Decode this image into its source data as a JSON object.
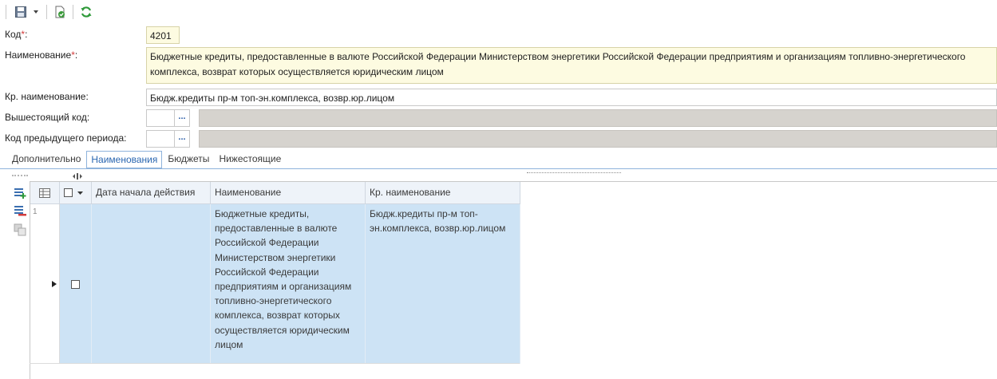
{
  "toolbar": {
    "save_icon": "save-icon",
    "dropdown_icon": "chevron-down-icon",
    "check_icon": "check-document-icon",
    "refresh_icon": "refresh-icon"
  },
  "form": {
    "code_label": "Код",
    "code_value": "4201",
    "name_label": "Наименование",
    "name_value": "Бюджетные кредиты, предоставленные в валюте Российской Федерации Министерством энергетики Российской Федерации предприятиям и организациям топливно-энергетического комплекса, возврат которых осуществляется юридическим лицом",
    "required_mark": "*",
    "label_colon": ":",
    "short_name_label": "Кр. наименование:",
    "short_name_value": "Бюдж.кредиты пр-м топ-эн.комплекса, возвр.юр.лицом",
    "parent_code_label": "Вышестоящий код:",
    "prev_period_code_label": "Код предыдущего периода:",
    "ellipsis": "..."
  },
  "tabs": [
    {
      "label": "Дополнительно",
      "active": false
    },
    {
      "label": "Наименования",
      "active": true
    },
    {
      "label": "Бюджеты",
      "active": false
    },
    {
      "label": "Нижестоящие",
      "active": false
    }
  ],
  "grid": {
    "columns": [
      "Дата начала действия",
      "Наименование",
      "Кр. наименование"
    ],
    "rows": [
      {
        "num": "1",
        "start_date": "",
        "name": "Бюджетные кредиты, предоставленные в валюте Российской Федерации Министерством энергетики Российской Федерации предприятиям и организациям топливно-энергетического комплекса, возврат которых осуществляется юридическим лицом",
        "short_name": "Бюдж.кредиты пр-м топ-эн.комплекса, возвр.юр.лицом"
      }
    ]
  },
  "colors": {
    "accent": "#2a66b0",
    "selected_row": "#cde3f5",
    "required": "#d23b3b",
    "yellow_field": "#fdfbe1"
  }
}
